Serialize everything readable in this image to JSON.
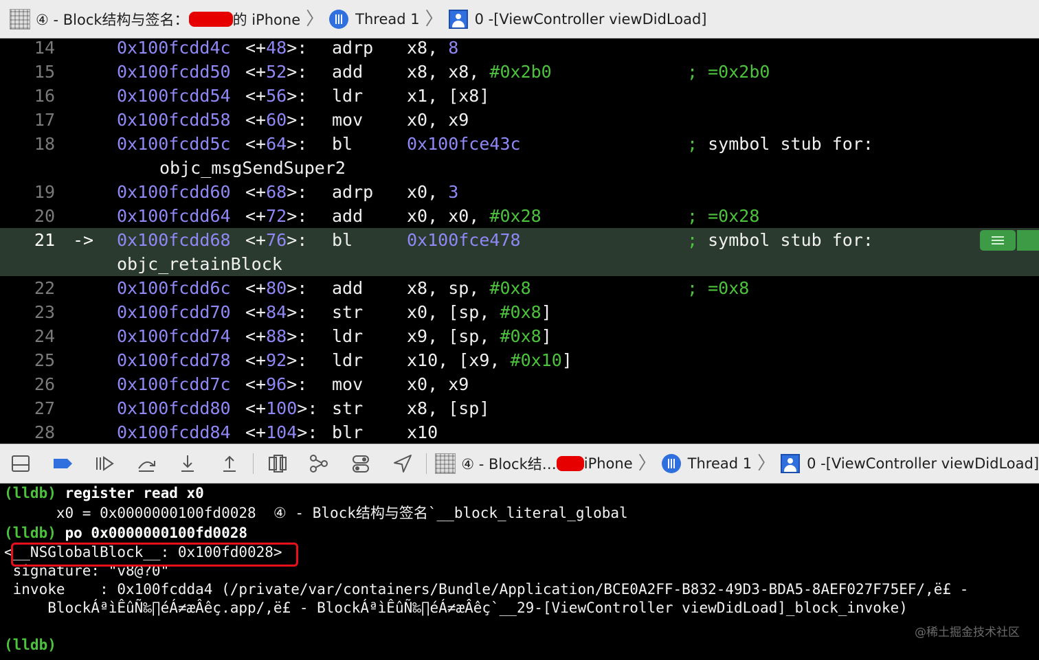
{
  "jumpbar": {
    "target_label": "④ - Block结构与签名：",
    "device_suffix": "的 iPhone",
    "thread_label": "Thread 1",
    "frame_label": "0 -[ViewController viewDidLoad]"
  },
  "disassembly": [
    {
      "line": "14",
      "addr": "0x100fcdd4c",
      "off_open": "<+",
      "off_num": "48",
      "off_close": ">:",
      "mnemonic": "adrp",
      "ops_pre": "x8, ",
      "ops_num": "8",
      "ops_imm": "",
      "ops_post": "",
      "comment_semi": "",
      "comment": "",
      "comment_val": ""
    },
    {
      "line": "15",
      "addr": "0x100fcdd50",
      "off_open": "<+",
      "off_num": "52",
      "off_close": ">:",
      "mnemonic": "add",
      "ops_pre": "x8, x8, ",
      "ops_num": "",
      "ops_imm": "#0x2b0",
      "ops_post": "",
      "comment_semi": ";",
      "comment": " ",
      "comment_val": "=0x2b0"
    },
    {
      "line": "16",
      "addr": "0x100fcdd54",
      "off_open": "<+",
      "off_num": "56",
      "off_close": ">:",
      "mnemonic": "ldr",
      "ops_pre": "x1, [x8]",
      "ops_num": "",
      "ops_imm": "",
      "ops_post": "",
      "comment_semi": "",
      "comment": "",
      "comment_val": ""
    },
    {
      "line": "17",
      "addr": "0x100fcdd58",
      "off_open": "<+",
      "off_num": "60",
      "off_close": ">:",
      "mnemonic": "mov",
      "ops_pre": "x0, x9",
      "ops_num": "",
      "ops_imm": "",
      "ops_post": "",
      "comment_semi": "",
      "comment": "",
      "comment_val": ""
    },
    {
      "line": "18",
      "addr": "0x100fcdd5c",
      "off_open": "<+",
      "off_num": "64",
      "off_close": ">:",
      "mnemonic": "bl",
      "ops_pre": "",
      "ops_num": "0x100fce43c",
      "ops_imm": "",
      "ops_post": "",
      "comment_semi": ";",
      "comment": " symbol stub for:",
      "comment_val": ""
    },
    {
      "line": "19",
      "addr": "0x100fcdd60",
      "off_open": "<+",
      "off_num": "68",
      "off_close": ">:",
      "mnemonic": "adrp",
      "ops_pre": "x0, ",
      "ops_num": "3",
      "ops_imm": "",
      "ops_post": "",
      "comment_semi": "",
      "comment": "",
      "comment_val": ""
    },
    {
      "line": "20",
      "addr": "0x100fcdd64",
      "off_open": "<+",
      "off_num": "72",
      "off_close": ">:",
      "mnemonic": "add",
      "ops_pre": "x0, x0, ",
      "ops_num": "",
      "ops_imm": "#0x28",
      "ops_post": "",
      "comment_semi": ";",
      "comment": " ",
      "comment_val": "=0x28"
    },
    {
      "line": "21",
      "addr": "0x100fcdd68",
      "off_open": "<+",
      "off_num": "76",
      "off_close": ">:",
      "mnemonic": "bl",
      "ops_pre": "",
      "ops_num": "0x100fce478",
      "ops_imm": "",
      "ops_post": "",
      "comment_semi": ";",
      "comment": " symbol stub for:",
      "comment_val": ""
    },
    {
      "line": "22",
      "addr": "0x100fcdd6c",
      "off_open": "<+",
      "off_num": "80",
      "off_close": ">:",
      "mnemonic": "add",
      "ops_pre": "x8, sp, ",
      "ops_num": "",
      "ops_imm": "#0x8",
      "ops_post": "",
      "comment_semi": ";",
      "comment": " ",
      "comment_val": "=0x8"
    },
    {
      "line": "23",
      "addr": "0x100fcdd70",
      "off_open": "<+",
      "off_num": "84",
      "off_close": ">:",
      "mnemonic": "str",
      "ops_pre": "x0, [sp, ",
      "ops_num": "",
      "ops_imm": "#0x8",
      "ops_post": "]",
      "comment_semi": "",
      "comment": "",
      "comment_val": ""
    },
    {
      "line": "24",
      "addr": "0x100fcdd74",
      "off_open": "<+",
      "off_num": "88",
      "off_close": ">:",
      "mnemonic": "ldr",
      "ops_pre": "x9, [sp, ",
      "ops_num": "",
      "ops_imm": "#0x8",
      "ops_post": "]",
      "comment_semi": "",
      "comment": "",
      "comment_val": ""
    },
    {
      "line": "25",
      "addr": "0x100fcdd78",
      "off_open": "<+",
      "off_num": "92",
      "off_close": ">:",
      "mnemonic": "ldr",
      "ops_pre": "x10, [x9, ",
      "ops_num": "",
      "ops_imm": "#0x10",
      "ops_post": "]",
      "comment_semi": "",
      "comment": "",
      "comment_val": ""
    },
    {
      "line": "26",
      "addr": "0x100fcdd7c",
      "off_open": "<+",
      "off_num": "96",
      "off_close": ">:",
      "mnemonic": "mov",
      "ops_pre": "x0, x9",
      "ops_num": "",
      "ops_imm": "",
      "ops_post": "",
      "comment_semi": "",
      "comment": "",
      "comment_val": ""
    },
    {
      "line": "27",
      "addr": "0x100fcdd80",
      "off_open": "<+",
      "off_num": "100",
      "off_close": ">:",
      "mnemonic": "str",
      "ops_pre": "x8, [sp]",
      "ops_num": "",
      "ops_imm": "",
      "ops_post": "",
      "comment_semi": "",
      "comment": "",
      "comment_val": ""
    },
    {
      "line": "28",
      "addr": "0x100fcdd84",
      "off_open": "<+",
      "off_num": "104",
      "off_close": ">:",
      "mnemonic": "blr",
      "ops_pre": "x10",
      "ops_num": "",
      "ops_imm": "",
      "ops_post": "",
      "comment_semi": "",
      "comment": "",
      "comment_val": ""
    }
  ],
  "continuations": {
    "after_18": "objc_msgSendSuper2",
    "after_21": "objc_retainBlock"
  },
  "current_pc_marker": "->",
  "debugbar": {
    "target_label": "④ - Block结…",
    "device_suffix": " iPhone",
    "thread_label": "Thread 1",
    "frame_label": "0 -[ViewController viewDidLoad]"
  },
  "console": {
    "prompt": "(lldb)",
    "cmd1": " register read x0",
    "out1": "      x0 = 0x0000000100fd0028  ④ - Block结构与签名`__block_literal_global",
    "cmd2": " po 0x0000000100fd0028",
    "out2": "<__NSGlobalBlock__: 0x100fd0028>",
    "out3": " signature: \"v8@?0\"",
    "out4": " invoke    : 0x100fcdda4 (/private/var/containers/Bundle/Application/BCE0A2FF-B832-49D3-BDA5-8AEF027F75EF/‚ë£ -",
    "out5": "     BlockÁªìÊûÑ‰∏éÁ≠æÂêç.app/‚ë£ - BlockÁªìÊûÑ‰∏éÁ≠æÂêç`__29-[ViewController viewDidLoad]_block_invoke)",
    "final_prompt": "(lldb)"
  },
  "watermark": "@稀土掘金技术社区",
  "colors": {
    "address": "#8f88f5",
    "immediate": "#4cc23d",
    "prompt": "#4cc23d",
    "highlight_row": "#2a3a2e",
    "breakpoint": "#3d9a45",
    "annotation_box": "#e8101a"
  }
}
